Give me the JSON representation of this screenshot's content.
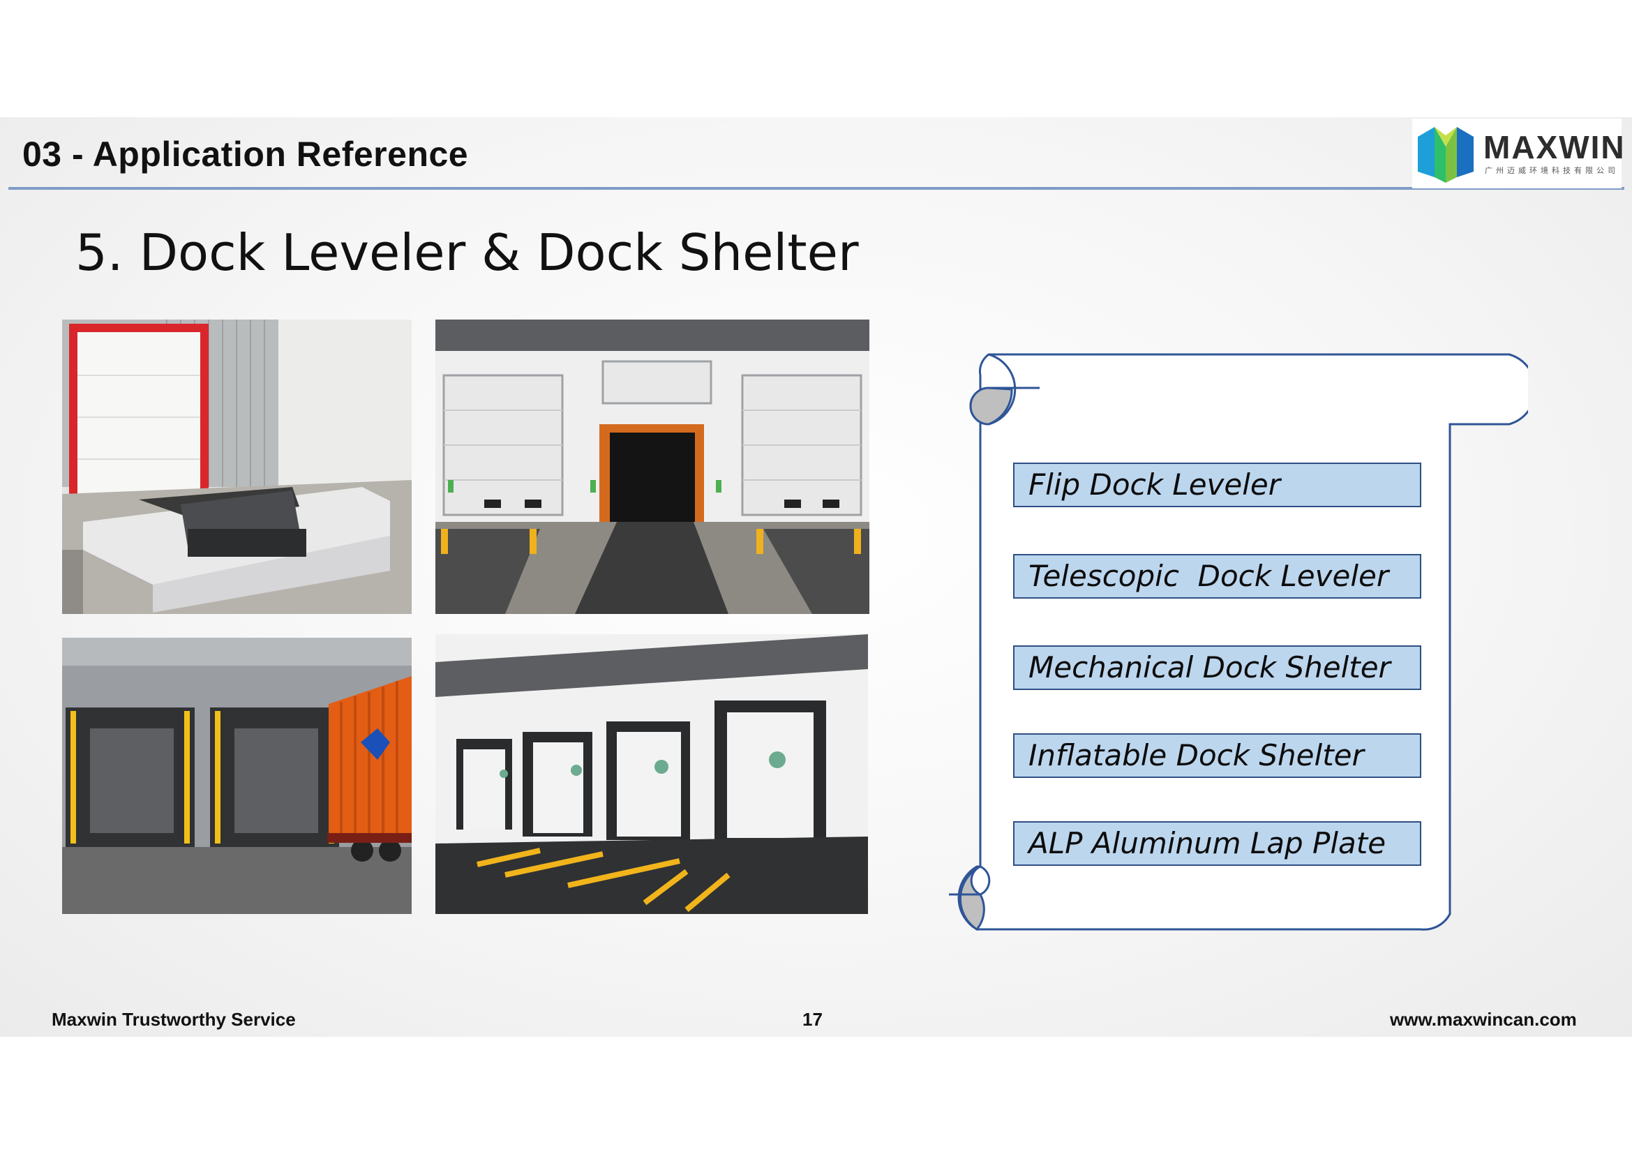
{
  "header": {
    "section_title": "03 - Application Reference",
    "logo_text": "MAXWIN",
    "logo_subtitle": "广州迈威环境科技有限公司"
  },
  "main": {
    "heading": "5. Dock Leveler & Dock Shelter",
    "product_list": [
      "Flip Dock Leveler",
      "Telescopic  Dock Leveler",
      "Mechanical Dock Shelter",
      "Inflatable Dock Shelter",
      "ALP Aluminum Lap Plate"
    ],
    "photos": [
      {
        "icon": "dock-leveler-photo"
      },
      {
        "icon": "loading-bay-doors-photo"
      },
      {
        "icon": "dock-shelter-container-photo"
      },
      {
        "icon": "warehouse-dock-doors-photo"
      }
    ]
  },
  "footer": {
    "left": "Maxwin Trustworthy Service",
    "page_number": "17",
    "website": "www.maxwincan.com"
  },
  "colors": {
    "accent_rule": "#7f9cc6",
    "list_fill": "#bcd6ee",
    "list_border": "#2f4f84",
    "scroll_stroke": "#2f5597"
  }
}
